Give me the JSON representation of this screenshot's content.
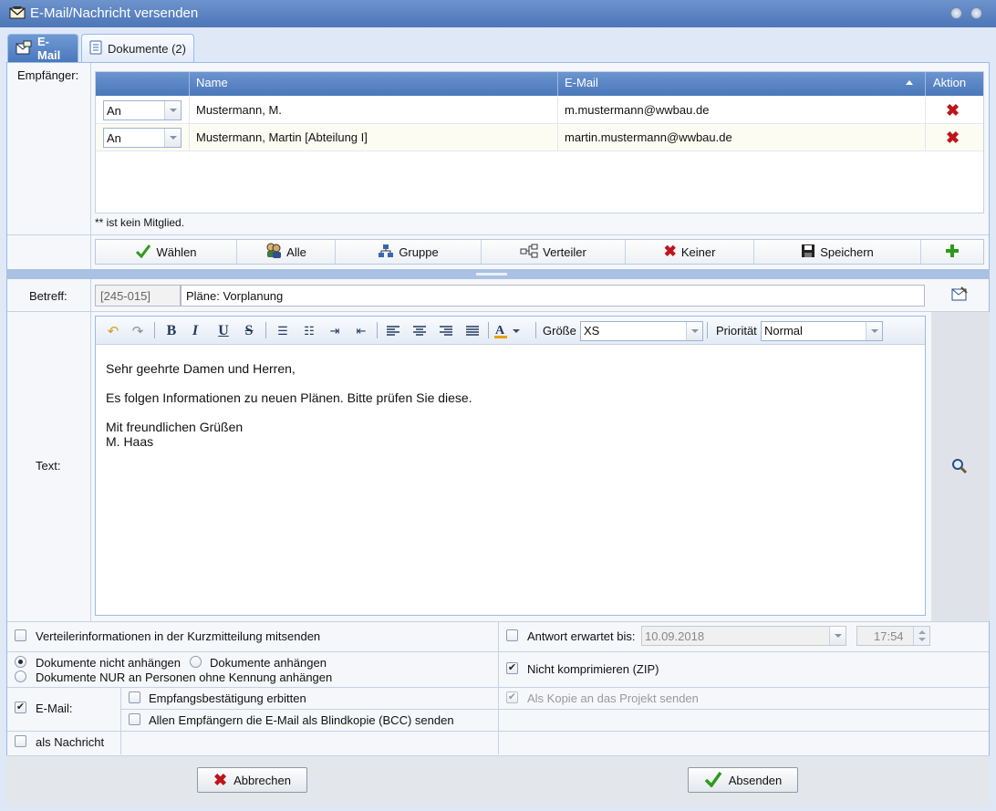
{
  "window": {
    "title": "E-Mail/Nachricht versenden"
  },
  "tabs": [
    {
      "label": "E-Mail"
    },
    {
      "label": "Dokumente (2)"
    }
  ],
  "recipients": {
    "label": "Empfänger:",
    "columns": {
      "name": "Name",
      "email": "E-Mail",
      "action": "Aktion"
    },
    "rows": [
      {
        "type": "An",
        "name": "Mustermann, M.",
        "email": "m.mustermann@wwbau.de"
      },
      {
        "type": "An",
        "name": "Mustermann, Martin [Abteilung I]",
        "email": "martin.mustermann@wwbau.de"
      }
    ],
    "note": "** ist kein Mitglied."
  },
  "recipient_buttons": {
    "select": "Wählen",
    "all": "Alle",
    "group": "Gruppe",
    "distributor": "Verteiler",
    "none": "Keiner",
    "save": "Speichern"
  },
  "subject": {
    "label": "Betreff:",
    "code": "[245-015]",
    "value": "Pläne: Vorplanung"
  },
  "text": {
    "label": "Text:",
    "size_label": "Größe",
    "size_value": "XS",
    "priority_label": "Priorität",
    "priority_value": "Normal",
    "body": {
      "greeting": "Sehr geehrte Damen und Herren,",
      "line1": "Es folgen Informationen zu neuen Plänen. Bitte prüfen Sie diese.",
      "closing": "Mit freundlichen Grüßen",
      "signature": "M. Haas"
    }
  },
  "options": {
    "distributor_info": "Verteilerinformationen in der Kurzmitteilung mitsenden",
    "reply_expected": "Antwort erwartet bis:",
    "reply_date": "10.09.2018",
    "reply_time": "17:54",
    "docs_not_attach": "Dokumente nicht anhängen",
    "docs_attach": "Dokumente anhängen",
    "docs_only_no_id": "Dokumente NUR an Personen ohne Kennung anhängen",
    "no_compress": "Nicht komprimieren (ZIP)",
    "email": "E-Mail:",
    "receipt": "Empfangsbestätigung erbitten",
    "copy_project": "Als Kopie an das Projekt senden",
    "bcc": "Allen Empfängern die E-Mail als Blindkopie (BCC) senden",
    "as_message": "als Nachricht"
  },
  "footer": {
    "cancel": "Abbrechen",
    "send": "Absenden"
  },
  "colors": {
    "accent": "#4a77ba",
    "delete": "#c0141b",
    "confirm": "#2f9a1c"
  }
}
